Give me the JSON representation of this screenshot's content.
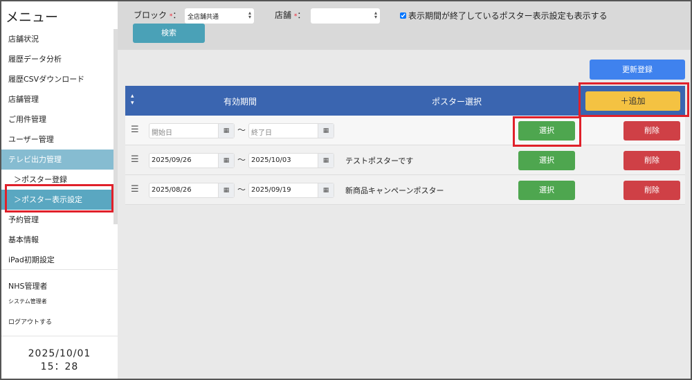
{
  "sidebar": {
    "title": "メニュー",
    "items": [
      {
        "label": "店舗状況"
      },
      {
        "label": "履歴データ分析"
      },
      {
        "label": "履歴CSVダウンロード"
      },
      {
        "label": "店舗管理"
      },
      {
        "label": "ご用件管理"
      },
      {
        "label": "ユーザー管理"
      },
      {
        "label": "テレビ出力管理"
      },
      {
        "label": "＞ポスター登録"
      },
      {
        "label": "＞ポスター表示設定"
      },
      {
        "label": "予約管理"
      },
      {
        "label": "基本情報"
      },
      {
        "label": "iPad初期設定"
      }
    ],
    "company": "NHS管理者",
    "role": "システム管理者",
    "logout": "ログアウトする",
    "date": "2025/10/01",
    "time": "15：28"
  },
  "filter": {
    "block_label": "ブロック",
    "block_value": "全店舗共通",
    "store_label": "店舗",
    "store_value": "",
    "required": "*",
    "colon": "：",
    "show_expired_label": "表示期間が終了しているポスター表示設定も表示する",
    "show_expired_checked": true,
    "search_button": "検索"
  },
  "actions": {
    "update_button": "更新登録",
    "add_button": "＋追加"
  },
  "table": {
    "headers": {
      "period": "有効期間",
      "poster": "ポスター選択"
    },
    "start_placeholder": "開始日",
    "end_placeholder": "終了日",
    "tilde": "〜",
    "select_button": "選択",
    "delete_button": "削除",
    "rows": [
      {
        "start": "",
        "end": "",
        "poster": ""
      },
      {
        "start": "2025/09/26",
        "end": "2025/10/03",
        "poster": "テストポスターです"
      },
      {
        "start": "2025/08/26",
        "end": "2025/09/19",
        "poster": "新商品キャンペーンポスター"
      }
    ]
  }
}
